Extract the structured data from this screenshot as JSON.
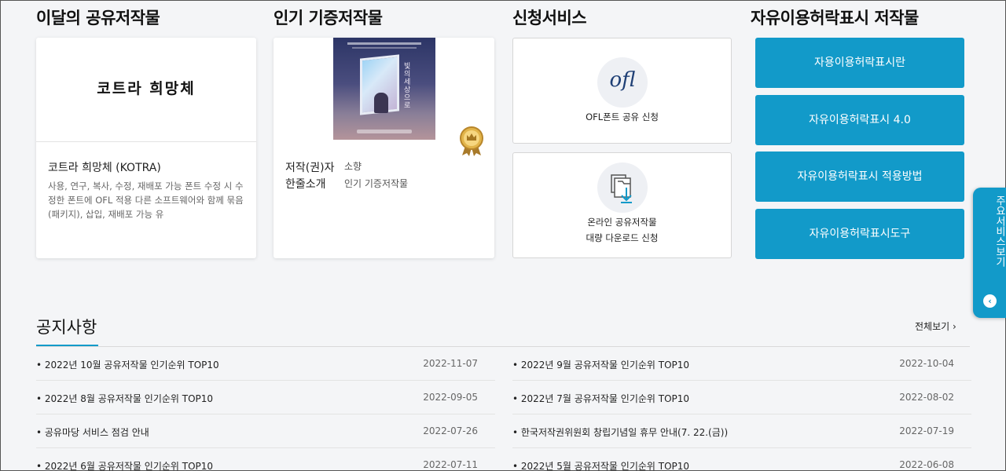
{
  "sections": {
    "monthly_title": "이달의 공유저작물",
    "donated_title": "인기 기증저작물",
    "apply_title": "신청서비스",
    "license_title": "자유이용허락표시 저작물"
  },
  "monthly_card": {
    "font_sample": "코트라 희망체",
    "title": "코트라 희망체 (KOTRA)",
    "description": "사용, 연구, 복사, 수정, 재배포 가능 폰트 수정 시 수정한 폰트에 OFL 적용 다른 소프트웨어와 함께 묶음(패키지), 삽입, 재배포 가능 유"
  },
  "donated_card": {
    "book_title": "빛의 세상으로",
    "author_label": "저작(권)자",
    "author_value": "소향",
    "summary_label": "한줄소개",
    "summary_value": "인기 기증저작물"
  },
  "services": {
    "ofl_logo": "ofl",
    "ofl_label": "OFL폰트 공유 신청",
    "bulk_label_1": "온라인 공유저작물",
    "bulk_label_2": "대량 다운로드 신청"
  },
  "license_buttons": [
    "자용이용허락표시란",
    "자유이용허락표시 4.0",
    "자유이용허락표시 적용방법",
    "자유이용허락표시도구"
  ],
  "floating_tab": {
    "label": "주요서비스보기"
  },
  "notices": {
    "title": "공지사항",
    "view_all": "전체보기 ›",
    "left": [
      {
        "title": "• 2022년 10월 공유저작물 인기순위 TOP10",
        "date": "2022-11-07"
      },
      {
        "title": "• 2022년 8월 공유저작물 인기순위 TOP10",
        "date": "2022-09-05"
      },
      {
        "title": "• 공유마당 서비스 점검 안내",
        "date": "2022-07-26"
      },
      {
        "title": "• 2022년 6월 공유저작물 인기순위 TOP10",
        "date": "2022-07-11"
      }
    ],
    "right": [
      {
        "title": "• 2022년 9월 공유저작물 인기순위 TOP10",
        "date": "2022-10-04"
      },
      {
        "title": "• 2022년 7월 공유저작물 인기순위 TOP10",
        "date": "2022-08-02"
      },
      {
        "title": "• 한국저작권위원회 창립기념일 휴무 안내(7. 22.(금))",
        "date": "2022-07-19"
      },
      {
        "title": "• 2022년 5월 공유저작물 인기순위 TOP10",
        "date": "2022-06-08"
      }
    ]
  },
  "colors": {
    "accent": "#129ac9",
    "ofl_text": "#1e3f75"
  }
}
